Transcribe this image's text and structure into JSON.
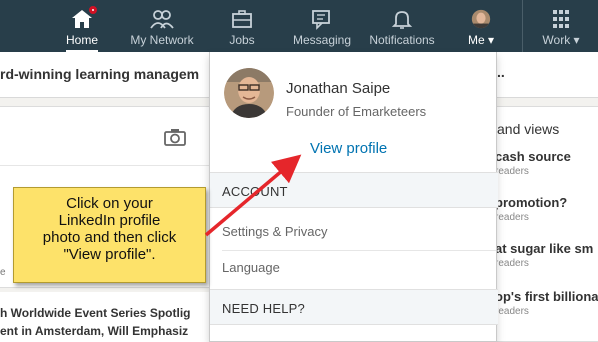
{
  "nav": {
    "items": [
      {
        "label": "Home",
        "icon": "home-icon",
        "active": true,
        "has_badge": true
      },
      {
        "label": "My Network",
        "icon": "network-icon"
      },
      {
        "label": "Jobs",
        "icon": "briefcase-icon"
      },
      {
        "label": "Messaging",
        "icon": "messaging-icon"
      },
      {
        "label": "Notifications",
        "icon": "bell-icon"
      },
      {
        "label": "Me",
        "icon": "avatar",
        "caret": "▾"
      },
      {
        "label": "Work",
        "icon": "grid-icon",
        "caret": "▾"
      }
    ],
    "background": "#283e4a"
  },
  "page": {
    "banner_text": "rd-winning learning managem",
    "banner_ellipsis": "..",
    "left_card_fragment": "e",
    "news_lines": [
      "h Worldwide Event Series Spotlig",
      "ent in Amsterdam, Will Emphasiz"
    ],
    "right_title": "and views",
    "right_items": [
      {
        "title": "cash source",
        "sub": "readers"
      },
      {
        "title": "promotion?",
        "sub": "readers"
      },
      {
        "title": "at sugar like sm",
        "sub": "readers"
      },
      {
        "title": "op's first billiona",
        "sub": "readers"
      }
    ]
  },
  "dropdown": {
    "name": "Jonathan Saipe",
    "headline": "Founder of Emarketeers",
    "view_profile": "View profile",
    "account_header": "ACCOUNT",
    "settings": "Settings & Privacy",
    "language": "Language",
    "help_header": "NEED HELP?"
  },
  "callout": {
    "lines": [
      "Click on your",
      "LinkedIn profile",
      "photo and then click",
      "\"View profile\"."
    ],
    "color": "#fde26a"
  },
  "colors": {
    "link": "#0073b1",
    "arrow": "#e5262b"
  }
}
